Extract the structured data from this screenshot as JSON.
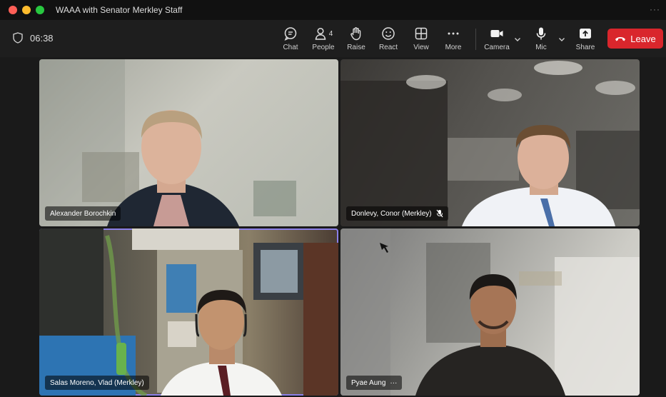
{
  "window": {
    "title": "WAAA with Senator Merkley Staff"
  },
  "meeting": {
    "elapsed": "06:38"
  },
  "toolbar": {
    "chat": "Chat",
    "people": "People",
    "people_count": "4",
    "raise": "Raise",
    "react": "React",
    "view": "View",
    "more": "More",
    "camera": "Camera",
    "mic": "Mic",
    "share": "Share",
    "leave": "Leave"
  },
  "participants": [
    {
      "name": "Alexander Borochkin",
      "muted": false
    },
    {
      "name": "Donlevy, Conor (Merkley)",
      "muted": true
    },
    {
      "name": "Salas Moreno, Vlad (Merkley)",
      "muted": false,
      "active_speaker": true
    },
    {
      "name": "Pyae Aung",
      "muted": false,
      "more": "···"
    }
  ],
  "colors": {
    "leave": "#d9262c",
    "active_border": "#8b7fe8"
  }
}
